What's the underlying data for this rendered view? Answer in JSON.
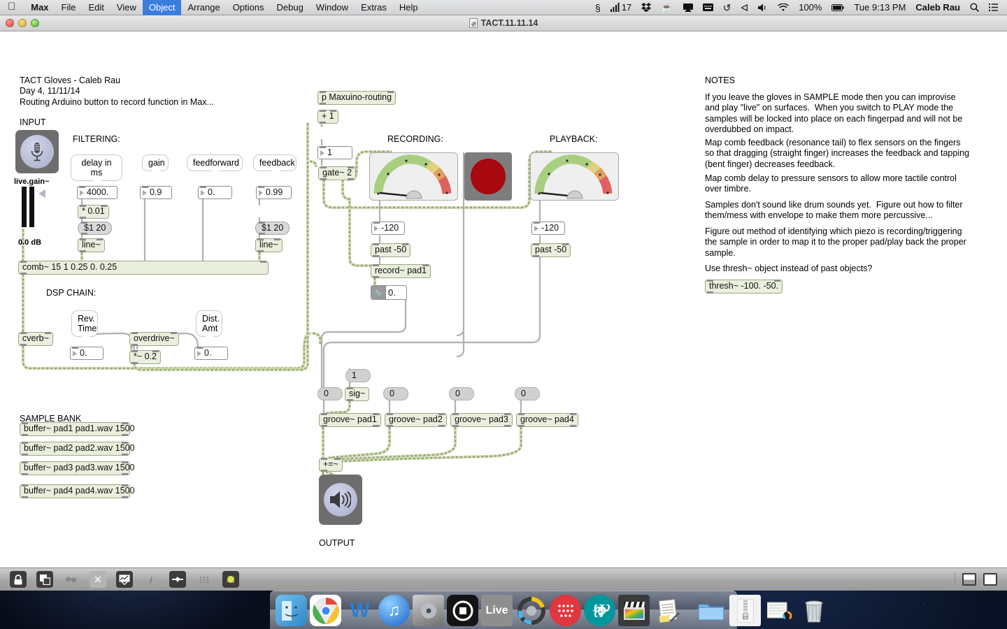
{
  "menubar": {
    "apple_icon": "apple-logo-icon",
    "items": [
      {
        "label": "Max",
        "bold": true,
        "active": false
      },
      {
        "label": "File",
        "bold": false,
        "active": false
      },
      {
        "label": "Edit",
        "bold": false,
        "active": false
      },
      {
        "label": "View",
        "bold": false,
        "active": false
      },
      {
        "label": "Object",
        "bold": false,
        "active": true
      },
      {
        "label": "Arrange",
        "bold": false,
        "active": false
      },
      {
        "label": "Options",
        "bold": false,
        "active": false
      },
      {
        "label": "Debug",
        "bold": false,
        "active": false
      },
      {
        "label": "Window",
        "bold": false,
        "active": false
      },
      {
        "label": "Extras",
        "bold": false,
        "active": false
      },
      {
        "label": "Help",
        "bold": false,
        "active": false
      }
    ],
    "status": {
      "paragraph_icon": "section-sign-icon",
      "notifier_icon": "signal-bars-icon",
      "notifier_count": "17",
      "dropbox_icon": "dropbox-icon",
      "caffeine_icon": "coffee-cup-icon",
      "airplay_icon": "airplay-icon",
      "keyboard_icon": "keyboard-icon",
      "timemachine_icon": "time-machine-icon",
      "bluetooth_icon": "bluetooth-icon",
      "volume_icon": "speaker-icon",
      "wifi_icon": "wifi-icon",
      "battery_percent": "100%",
      "battery_icon": "battery-icon",
      "clock": "Tue 9:13 PM",
      "user": "Caleb Rau",
      "search_icon": "spotlight-search-icon",
      "notification_icon": "notification-center-icon"
    }
  },
  "window": {
    "title": "TACT.11.11.14",
    "doc_icon": "max-patcher-document-icon",
    "traffic_lights": [
      "close-button",
      "minimize-button",
      "zoom-button"
    ]
  },
  "patcher": {
    "header_comment": "TACT Gloves - Caleb Rau\nDay 4, 11/11/14\nRouting Arduino button to record function in Max...",
    "labels": {
      "input": "INPUT",
      "filtering": "FILTERING:",
      "dsp_chain": "DSP CHAIN:",
      "sample_bank": "SAMPLE BANK",
      "recording": "RECORDING:",
      "playback": "PLAYBACK:",
      "output": "OUTPUT",
      "notes": "NOTES",
      "live_gain": "live.gain~",
      "gain_db": "0.0 dB"
    },
    "filtering": {
      "bubbles": [
        "delay in ms",
        "gain",
        "feedforward",
        "feedback"
      ],
      "numbers": [
        "4000.",
        "0.9",
        "0.",
        "0.99"
      ],
      "mult_object": "* 0.01",
      "msg_delay": "$1 20",
      "msg_feedback": "$1 20",
      "line_left": "line~",
      "line_right": "line~",
      "comb_object": "comb~ 15 1 0.25 0. 0.25"
    },
    "dsp": {
      "cverb": "cverb~",
      "rev_time_label": "Rev.\nTime",
      "rev_time_value": "0.",
      "overdrive": "overdrive~",
      "times_object": "*~ 0.2",
      "dist_amt_label": "Dist.\nAmt",
      "dist_amt_value": "0."
    },
    "sample_bank": [
      "buffer~ pad1 pad1.wav 1500",
      "buffer~ pad2 pad2.wav 1500",
      "buffer~ pad3 pad3.wav 1500",
      "buffer~ pad4 pad4.wav 1500"
    ],
    "routing": {
      "subpatch": "p Maxuino-routing",
      "plus_one": "+ 1",
      "num_one": "1",
      "gate": "gate~ 2"
    },
    "recording": {
      "meter_number": "-120",
      "past_object": "past -50",
      "record_object": "record~ pad1",
      "sig_display": "0.",
      "button_icon": "record-button"
    },
    "playback": {
      "meter_number": "-120",
      "past_object": "past -50"
    },
    "grooves": {
      "msg_one": "1",
      "sig_object": "sig~",
      "number_boxes": [
        "0",
        "0",
        "0",
        "0"
      ],
      "objects": [
        "groove~ pad1",
        "groove~ pad2",
        "groove~ pad3",
        "groove~ pad4"
      ],
      "sum_object": "+=~"
    },
    "notes_text": [
      "If you leave the gloves in SAMPLE mode then you can improvise and play \"live\" on surfaces.  When you switch to PLAY mode the samples will be locked into place on each fingerpad and will not be overdubbed on impact.",
      "Map comb feedback (resonance tail) to flex sensors on the fingers so that dragging (straight finger) increases the feedback and tapping (bent finger) decreases feedback.",
      "Map comb delay to pressure sensors to allow more tactile control over timbre.",
      "Samples don't sound like drum sounds yet.  Figure out how to filter them/mess with envelope to make them more percussive...",
      "Figure out method of identifying which piezo is recording/triggering the sample in order to map it to the proper pad/play back the proper sample.",
      "Use thresh~ object instead of past objects?"
    ],
    "thresh_object": "thresh~ -100. -50."
  },
  "maxbar": {
    "tools": [
      {
        "name": "lock-unlock-icon",
        "glyph": "🔒",
        "style": "dark"
      },
      {
        "name": "presentation-mode-icon",
        "glyph": "◰",
        "style": "dark"
      },
      {
        "name": "cord-view-icon",
        "glyph": "✂",
        "style": "plain"
      },
      {
        "name": "clear-cords-icon",
        "glyph": "✕",
        "style": "light"
      },
      {
        "name": "inspector-icon",
        "glyph": "↗",
        "style": "dark"
      },
      {
        "name": "info-icon",
        "glyph": "i",
        "style": "plain"
      },
      {
        "name": "object-defaults-icon",
        "glyph": "◆",
        "style": "dark"
      },
      {
        "name": "grid-snap-icon",
        "glyph": "∷",
        "style": "plain"
      },
      {
        "name": "audio-status-icon",
        "glyph": "●",
        "style": "dark"
      }
    ],
    "right": [
      {
        "name": "split-view-icon"
      },
      {
        "name": "sidebar-view-icon"
      }
    ]
  },
  "dock": {
    "items": [
      {
        "name": "finder-icon",
        "label": "",
        "bg": "#4da3e0"
      },
      {
        "name": "google-chrome-icon",
        "label": "",
        "bg": "#d9534f"
      },
      {
        "name": "word-icon",
        "label": "",
        "bg": "#2a7fd4"
      },
      {
        "name": "itunes-icon",
        "label": "",
        "bg": "#2f80d8"
      },
      {
        "name": "dvd-player-icon",
        "label": "",
        "bg": "#5a5a5a"
      },
      {
        "name": "max-icon",
        "label": "",
        "bg": "#1a1a1a"
      },
      {
        "name": "ableton-live-icon",
        "label": "Live",
        "bg": "#8e8e8e"
      },
      {
        "name": "logic-pro-icon",
        "label": "",
        "bg": "#f0c419"
      },
      {
        "name": "launchpad-icon",
        "label": "",
        "bg": "#e0363f"
      },
      {
        "name": "arduino-icon",
        "label": "",
        "bg": "#00979d"
      },
      {
        "name": "final-cut-pro-icon",
        "label": "",
        "bg": "#3a3a3a"
      },
      {
        "name": "textedit-icon",
        "label": "",
        "bg": "#f5f0e0"
      },
      {
        "name": "separator",
        "label": "",
        "bg": "transparent"
      },
      {
        "name": "documents-folder-icon",
        "label": "",
        "bg": "#5fa9e8"
      },
      {
        "name": "zip-archive-icon",
        "label": "",
        "bg": "#f2f2f2"
      },
      {
        "name": "downloads-stack-icon",
        "label": "",
        "bg": "#e8e2d4"
      },
      {
        "name": "trash-icon",
        "label": "",
        "bg": "#d8d8d8"
      }
    ]
  }
}
